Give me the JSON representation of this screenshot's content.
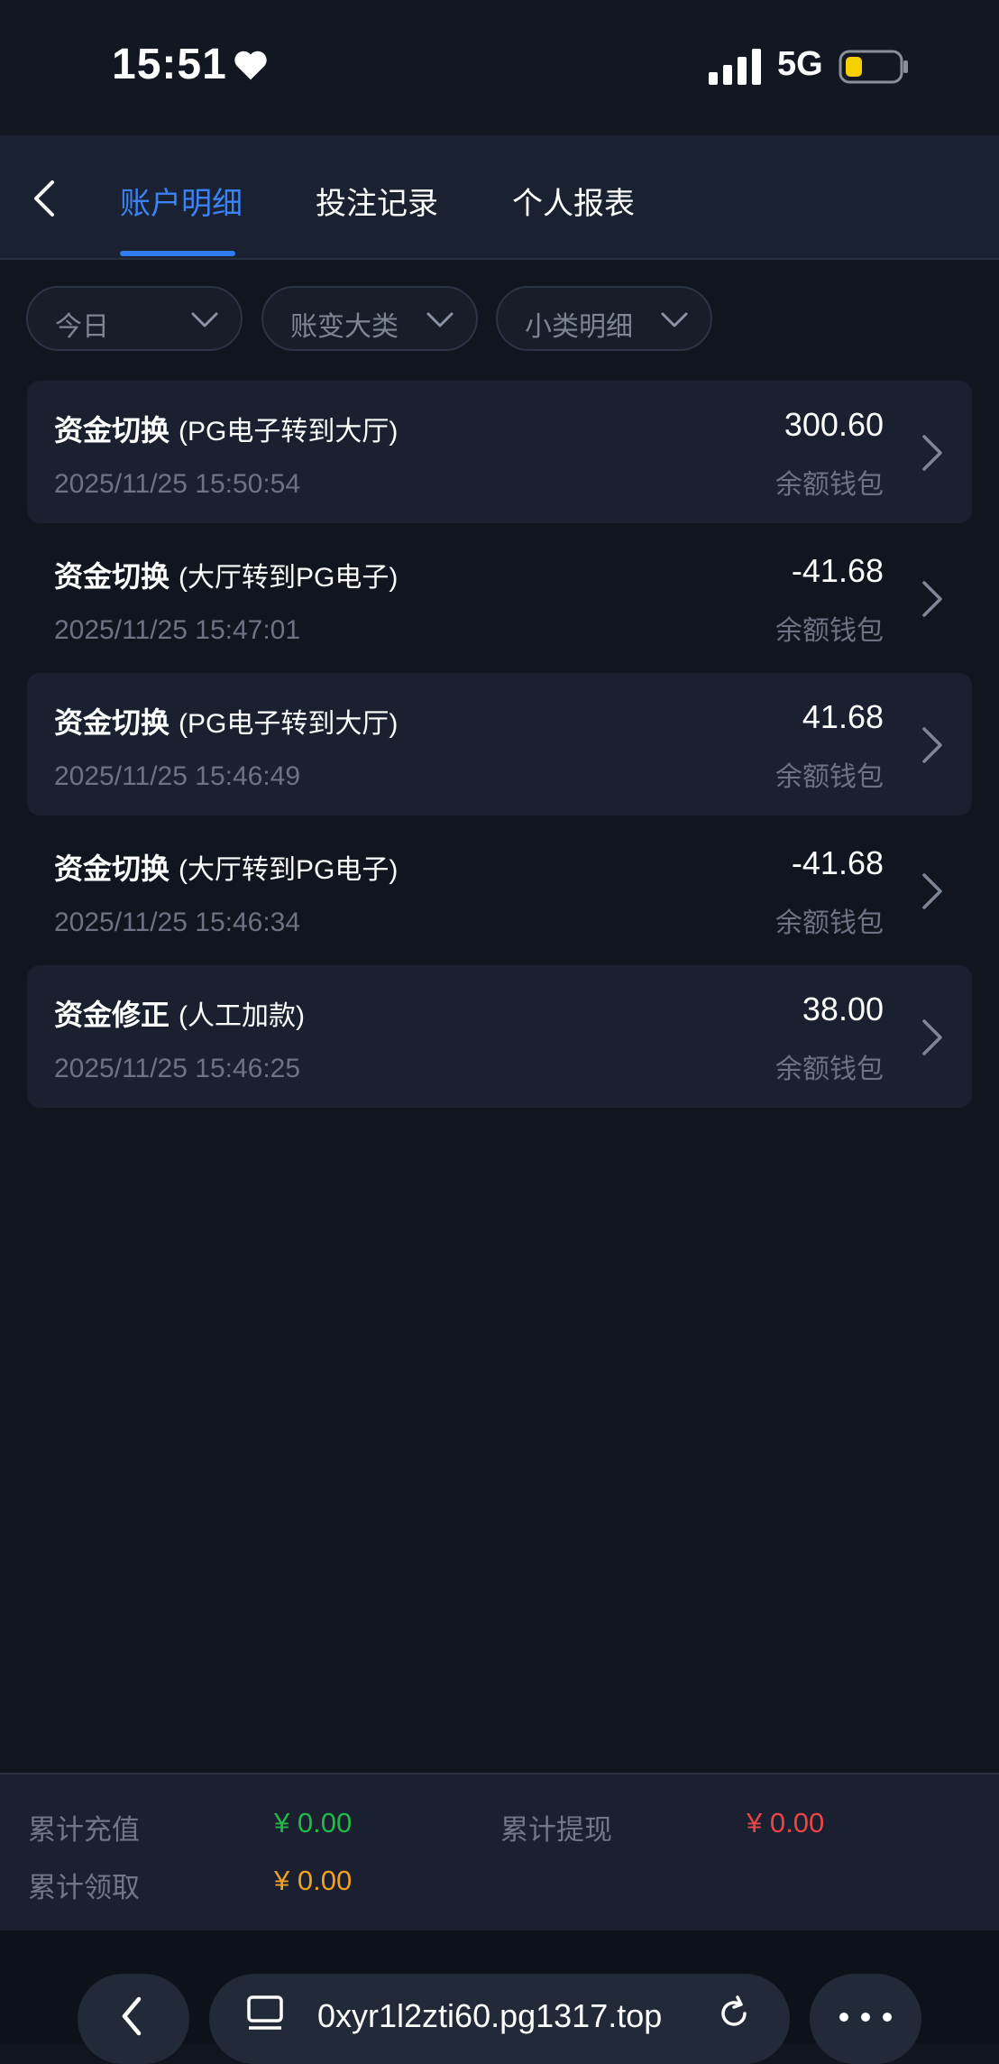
{
  "status_bar": {
    "time": "15:51",
    "network": "5G",
    "battery_color": "#f5d000"
  },
  "header": {
    "tabs": [
      {
        "label": "账户明细",
        "active": true
      },
      {
        "label": "投注记录",
        "active": false
      },
      {
        "label": "个人报表",
        "active": false
      }
    ]
  },
  "filters": [
    {
      "label": "今日"
    },
    {
      "label": "账变大类"
    },
    {
      "label": "小类明细"
    }
  ],
  "records": [
    {
      "title": "资金切换",
      "detail": "(PG电子转到大厅)",
      "time": "2025/11/25 15:50:54",
      "amount": "300.60",
      "wallet": "余额钱包"
    },
    {
      "title": "资金切换",
      "detail": "(大厅转到PG电子)",
      "time": "2025/11/25 15:47:01",
      "amount": "-41.68",
      "wallet": "余额钱包"
    },
    {
      "title": "资金切换",
      "detail": "(PG电子转到大厅)",
      "time": "2025/11/25 15:46:49",
      "amount": "41.68",
      "wallet": "余额钱包"
    },
    {
      "title": "资金切换",
      "detail": "(大厅转到PG电子)",
      "time": "2025/11/25 15:46:34",
      "amount": "-41.68",
      "wallet": "余额钱包"
    },
    {
      "title": "资金修正",
      "detail": "(人工加款)",
      "time": "2025/11/25 15:46:25",
      "amount": "38.00",
      "wallet": "余额钱包"
    }
  ],
  "summary": {
    "recharge_label": "累计充值",
    "recharge_value": "¥ 0.00",
    "withdraw_label": "累计提现",
    "withdraw_value": "¥ 0.00",
    "claim_label": "累计领取",
    "claim_value": "¥ 0.00",
    "colors": {
      "recharge": "#22b84a",
      "withdraw": "#e84545",
      "claim": "#f0a020"
    }
  },
  "browser": {
    "url": "0xyr1l2zti60.pg1317.top"
  },
  "colors": {
    "accent": "#3b82f6",
    "background": "#10151f"
  }
}
